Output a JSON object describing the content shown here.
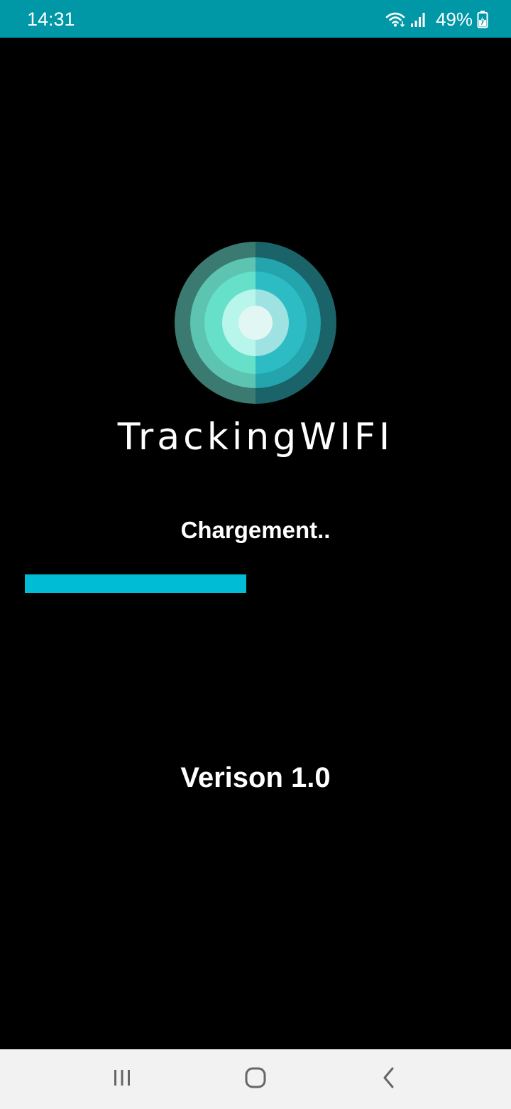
{
  "status_bar": {
    "time": "14:31",
    "battery_percent": "49%",
    "icons": [
      "wifi-icon",
      "signal-icon",
      "battery-charging-icon"
    ],
    "background_color": "#0097a7"
  },
  "splash": {
    "brand_name": "TrackingWIFI",
    "logo_icon": "concentric-circles-logo",
    "loading_label": "Chargement..",
    "progress_fraction": 0.48,
    "progress_color": "#00bcd4",
    "version_label": "Verison 1.0",
    "background_color": "#000000"
  },
  "nav_bar": {
    "buttons": [
      "recents-icon",
      "home-icon",
      "back-icon"
    ],
    "background_color": "#f2f2f2"
  }
}
